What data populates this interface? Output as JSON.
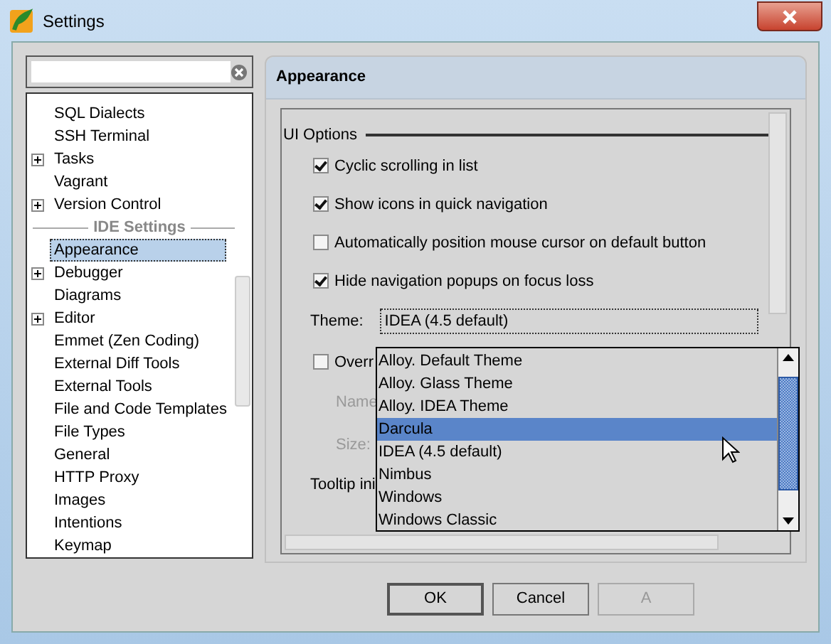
{
  "window": {
    "title": "Settings"
  },
  "tree": [
    {
      "kind": "item",
      "label": "SQL Dialects",
      "expandable": false,
      "selected": false
    },
    {
      "kind": "item",
      "label": "SSH Terminal",
      "expandable": false,
      "selected": false
    },
    {
      "kind": "item",
      "label": "Tasks",
      "expandable": true,
      "selected": false
    },
    {
      "kind": "item",
      "label": "Vagrant",
      "expandable": false,
      "selected": false
    },
    {
      "kind": "item",
      "label": "Version Control",
      "expandable": true,
      "selected": false
    },
    {
      "kind": "header",
      "label": "IDE Settings"
    },
    {
      "kind": "item",
      "label": "Appearance",
      "expandable": false,
      "selected": true
    },
    {
      "kind": "item",
      "label": "Debugger",
      "expandable": true,
      "selected": false
    },
    {
      "kind": "item",
      "label": "Diagrams",
      "expandable": false,
      "selected": false
    },
    {
      "kind": "item",
      "label": "Editor",
      "expandable": true,
      "selected": false
    },
    {
      "kind": "item",
      "label": "Emmet (Zen Coding)",
      "expandable": false,
      "selected": false
    },
    {
      "kind": "item",
      "label": "External Diff Tools",
      "expandable": false,
      "selected": false
    },
    {
      "kind": "item",
      "label": "External Tools",
      "expandable": false,
      "selected": false
    },
    {
      "kind": "item",
      "label": "File and Code Templates",
      "expandable": false,
      "selected": false
    },
    {
      "kind": "item",
      "label": "File Types",
      "expandable": false,
      "selected": false
    },
    {
      "kind": "item",
      "label": "General",
      "expandable": false,
      "selected": false
    },
    {
      "kind": "item",
      "label": "HTTP Proxy",
      "expandable": false,
      "selected": false
    },
    {
      "kind": "item",
      "label": "Images",
      "expandable": false,
      "selected": false
    },
    {
      "kind": "item",
      "label": "Intentions",
      "expandable": false,
      "selected": false
    },
    {
      "kind": "item",
      "label": "Keymap",
      "expandable": false,
      "selected": false
    }
  ],
  "page": {
    "title": "Appearance",
    "section": "UI Options",
    "options": [
      {
        "kind": "checkbox",
        "label": "Cyclic scrolling in list",
        "checked": true
      },
      {
        "kind": "checkbox",
        "label": "Show icons in quick navigation",
        "checked": true
      },
      {
        "kind": "checkbox",
        "label": "Automatically position mouse cursor on default button",
        "checked": false
      },
      {
        "kind": "checkbox",
        "label": "Hide navigation popups on focus loss",
        "checked": true
      },
      {
        "kind": "dropdown",
        "label": "Theme:",
        "value": "IDEA (4.5 default)"
      },
      {
        "kind": "checkbox",
        "label": "Overr",
        "checked": false
      },
      {
        "kind": "field",
        "label": "Name",
        "disabled": true
      },
      {
        "kind": "field",
        "label": "Size:",
        "disabled": true
      },
      {
        "kind": "text",
        "label": "Tooltip ini"
      }
    ]
  },
  "theme_popup": [
    {
      "label": "Alloy. Default Theme",
      "selected": false
    },
    {
      "label": "Alloy. Glass Theme",
      "selected": false
    },
    {
      "label": "Alloy. IDEA Theme",
      "selected": false
    },
    {
      "label": "Darcula",
      "selected": true
    },
    {
      "label": "IDEA (4.5 default)",
      "selected": false
    },
    {
      "label": "Nimbus",
      "selected": false
    },
    {
      "label": "Windows",
      "selected": false
    },
    {
      "label": "Windows Classic",
      "selected": false
    }
  ],
  "buttons": [
    {
      "label": "OK",
      "default": true,
      "disabled": false
    },
    {
      "label": "Cancel",
      "default": false,
      "disabled": false
    },
    {
      "label": "A",
      "default": false,
      "disabled": true
    }
  ]
}
